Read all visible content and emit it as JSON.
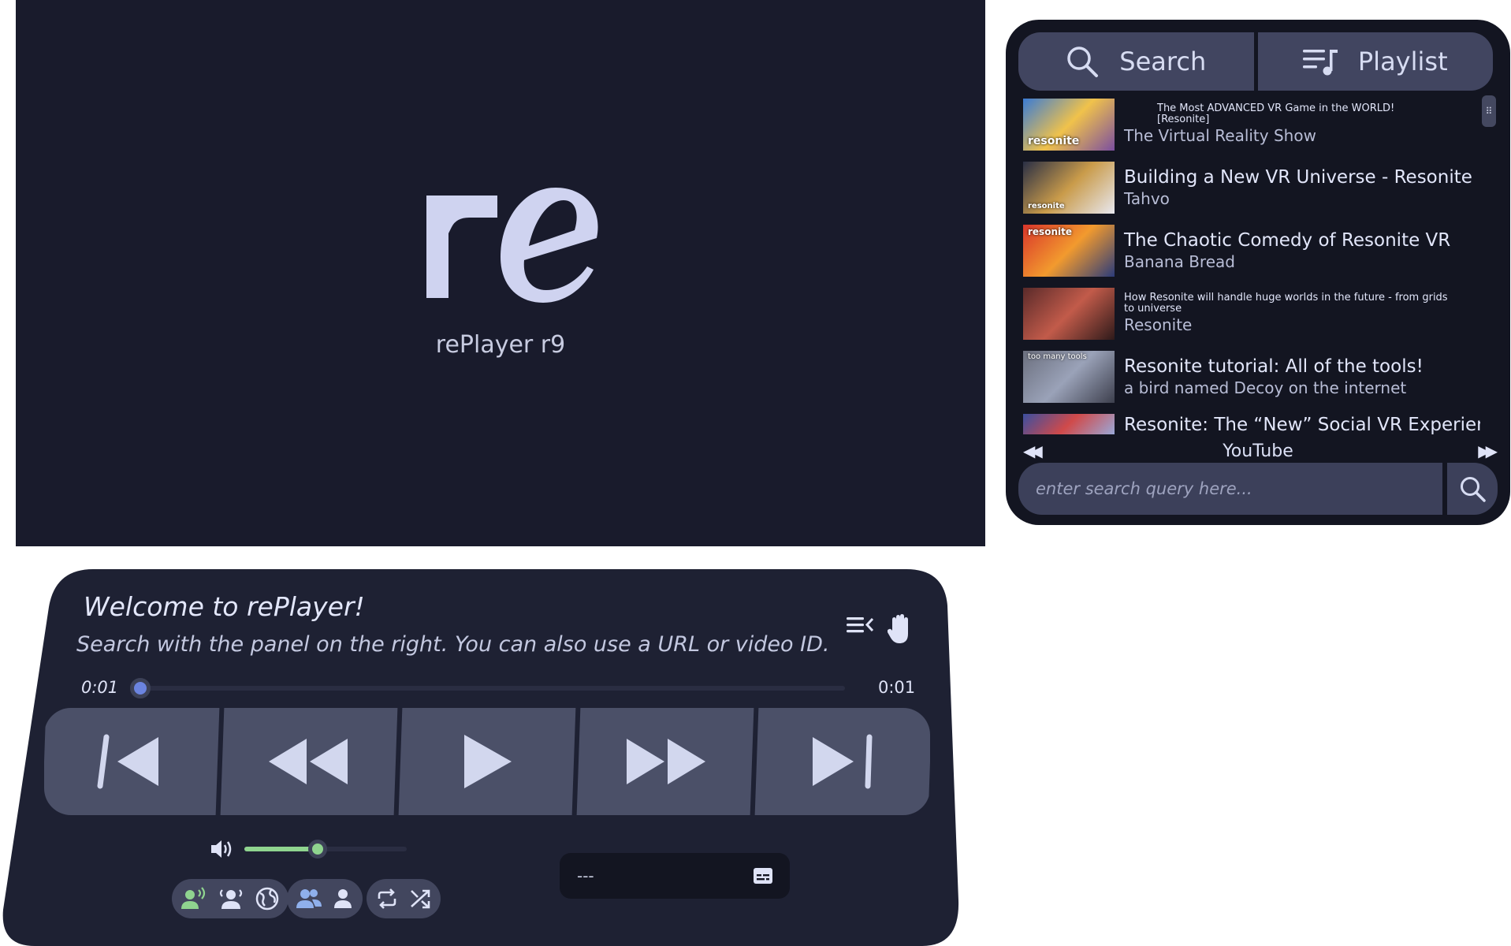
{
  "player": {
    "version_label": "rePlayer r9"
  },
  "panel": {
    "tabs": [
      {
        "label": "Search",
        "icon": "search-icon"
      },
      {
        "label": "Playlist",
        "icon": "playlist-icon"
      }
    ],
    "results": [
      {
        "title": "The Most ADVANCED VR Game in the WORLD! [Resonite]",
        "channel": "The Virtual Reality Show",
        "thumb_tag": "resonite",
        "thumb_colors": [
          "#3a7bd5",
          "#f0c24b",
          "#7b4ea0"
        ]
      },
      {
        "title": "Building a New VR Universe - Resonite",
        "channel": "Tahvo",
        "thumb_tag": "resonite",
        "thumb_colors": [
          "#2a2f45",
          "#c99b4a",
          "#e8e8f0"
        ]
      },
      {
        "title": "The Chaotic Comedy of Resonite VR",
        "channel": "Banana Bread",
        "thumb_tag": "resonite",
        "thumb_colors": [
          "#d9352b",
          "#f29a2e",
          "#2b3b7a"
        ]
      },
      {
        "title": "How Resonite will handle huge worlds in the future - from grids to universe",
        "channel": "Resonite",
        "thumb_tag": "",
        "thumb_colors": [
          "#5a2a2a",
          "#c25b4a",
          "#2e1a1a"
        ]
      },
      {
        "title": "Resonite tutorial: All of the tools!",
        "channel": "a bird named Decoy on the internet",
        "thumb_tag": "too many tools",
        "thumb_colors": [
          "#6b6f7e",
          "#9aa2b8",
          "#3d3f4d"
        ]
      },
      {
        "title": "Resonite: The “New” Social VR Experience",
        "channel": "",
        "thumb_tag": "",
        "thumb_colors": [
          "#3b4fa0",
          "#d04a4a",
          "#9aa8d8"
        ]
      }
    ],
    "source_label": "YouTube",
    "prev_icon": "rewind-icon",
    "next_icon": "fast-forward-icon",
    "search": {
      "placeholder": "enter search query here...",
      "value": ""
    }
  },
  "controller": {
    "welcome": "Welcome to rePlayer!",
    "subtitle": "Search with the panel on the right. You can also use a URL or video ID.",
    "time_current": "0:01",
    "time_total": "0:01",
    "progress": 0.0,
    "volume": 0.45,
    "subtitle_track": "---",
    "accent": "#6b84e0",
    "volume_color": "#8fd48f",
    "active_mode_color": "#8fd48f",
    "icons": {
      "queue": "queue-icon",
      "grab": "hand-icon",
      "volume": "speaker-icon",
      "subtitles": "subtitles-icon"
    }
  }
}
